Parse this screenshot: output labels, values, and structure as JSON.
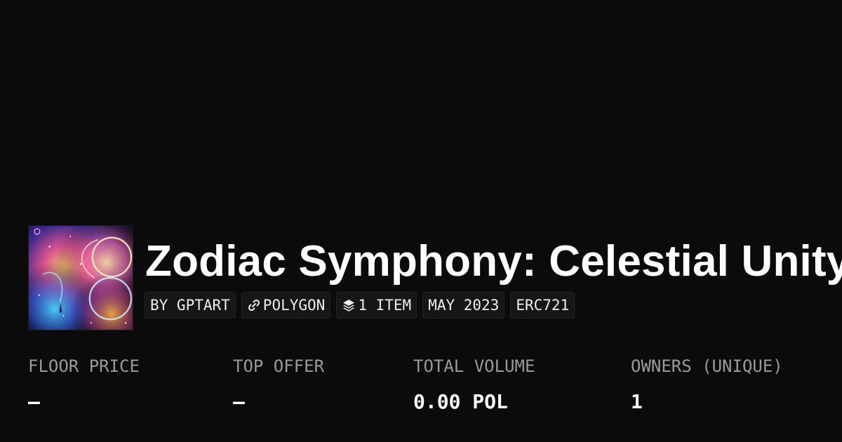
{
  "collection": {
    "title": "Zodiac Symphony: Celestial Unity",
    "thumbnail": "cosmic zodiac swirl artwork"
  },
  "tags": {
    "creator": "BY GPTART",
    "chain": "POLYGON",
    "chain_icon": "chain-link-icon",
    "items": "1 ITEM",
    "items_icon": "layers-icon",
    "date": "MAY 2023",
    "standard": "ERC721"
  },
  "stats": {
    "floor_price": {
      "label": "FLOOR PRICE",
      "value": "–"
    },
    "top_offer": {
      "label": "TOP OFFER",
      "value": "–"
    },
    "total_volume": {
      "label": "TOTAL VOLUME",
      "value": "0.00 POL"
    },
    "owners": {
      "label": "OWNERS (UNIQUE)",
      "value": "1"
    }
  },
  "colors": {
    "background": "#0b0b0b",
    "tag_background": "#161616",
    "label": "#9a9a9a",
    "text": "#ffffff"
  }
}
